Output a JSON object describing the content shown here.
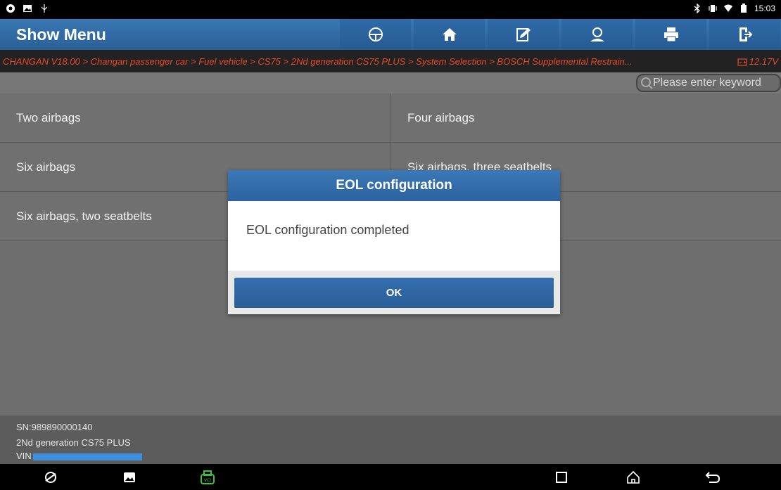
{
  "status_bar": {
    "left_icons": [
      "chrome-icon",
      "image-icon",
      "usb-icon"
    ],
    "right_icons": [
      "bluetooth-icon",
      "vibrate-icon",
      "wifi-icon",
      "battery-icon"
    ],
    "time": "15:03"
  },
  "header": {
    "title": "Show Menu",
    "buttons": [
      "steering-wheel-icon",
      "home-icon",
      "edit-icon",
      "user-icon",
      "print-icon",
      "exit-icon"
    ]
  },
  "breadcrumb": {
    "text": "CHANGAN V18.00 > Changan passenger car > Fuel vehicle > CS75 > 2Nd generation CS75 PLUS > System Selection > BOSCH Supplemental Restrain...",
    "voltage": "12.17V"
  },
  "search": {
    "placeholder": "Please enter keyword"
  },
  "menu": {
    "items": [
      "Two airbags",
      "Four airbags",
      "Six airbags",
      "Six airbags, three seatbelts",
      "Six airbags, two seatbelts"
    ]
  },
  "footer": {
    "sn": "SN:989890000140",
    "model": "2Nd generation CS75 PLUS",
    "vin_label": "VIN"
  },
  "dialog": {
    "title": "EOL configuration",
    "message": "EOL configuration completed",
    "ok": "OK"
  },
  "colors": {
    "header_blue": "#2f6aa7",
    "breadcrumb_red": "#e8482b",
    "vin_mask": "#3d8fe0",
    "vci_green": "#3cc23c"
  }
}
